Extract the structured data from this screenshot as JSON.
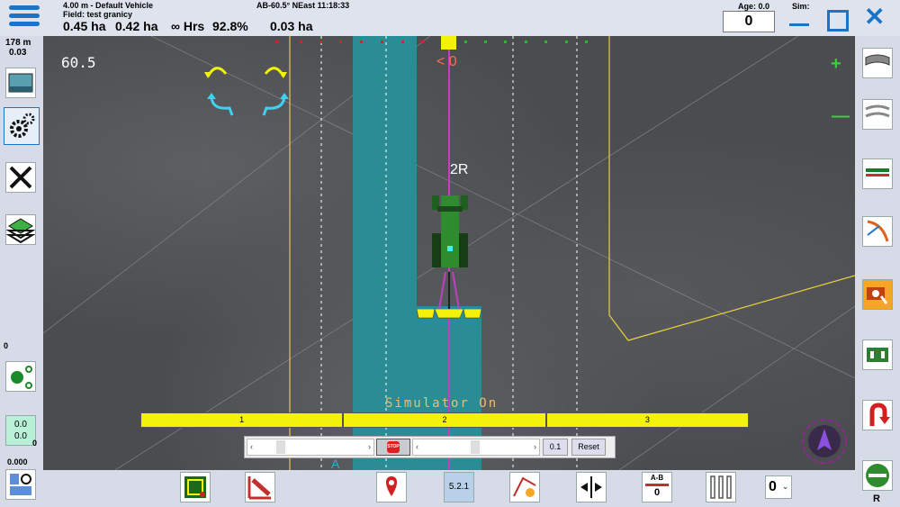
{
  "header": {
    "vehicle": "4.00 m - Default Vehicle",
    "field": "Field: test granicy",
    "ab_info": "AB-60.5° NEast 11:18:33",
    "area_worked": "0.45 ha",
    "area_actual": "0.42 ha",
    "hrs_label": "∞ Hrs",
    "percent": "92.8%",
    "area_remaining": "0.03 ha",
    "age_label": "Age: 0.0",
    "sim_label": "Sim:",
    "age_value": "0"
  },
  "left": {
    "distance": "178 m",
    "distance_sub": "0.03",
    "counter": "0",
    "box_top": "0.0",
    "box_bottom": "0.0",
    "box_right": "0",
    "speed": "0.000"
  },
  "field": {
    "heading": "60.5",
    "lane": "2R",
    "offset": "< 0",
    "sim_status": "Simulator On",
    "a_marker": "A",
    "sections": [
      "1",
      "2",
      "3"
    ]
  },
  "sim_controls": {
    "left_arrow": "‹",
    "right_arrow": "›",
    "stop_label": "STOP",
    "step_value": "0.1",
    "reset_label": "Reset"
  },
  "bottom": {
    "version": "5.2.1",
    "ab_label": "A-B",
    "ab_value": "0",
    "dropdown_value": "0"
  },
  "right": {
    "r_label": "R",
    "plus": "+",
    "minus": "—"
  },
  "colors": {
    "accent": "#1a75c8",
    "coverage": "#2a8c94",
    "section": "#f2f20a",
    "guidance": "#c040c0"
  }
}
